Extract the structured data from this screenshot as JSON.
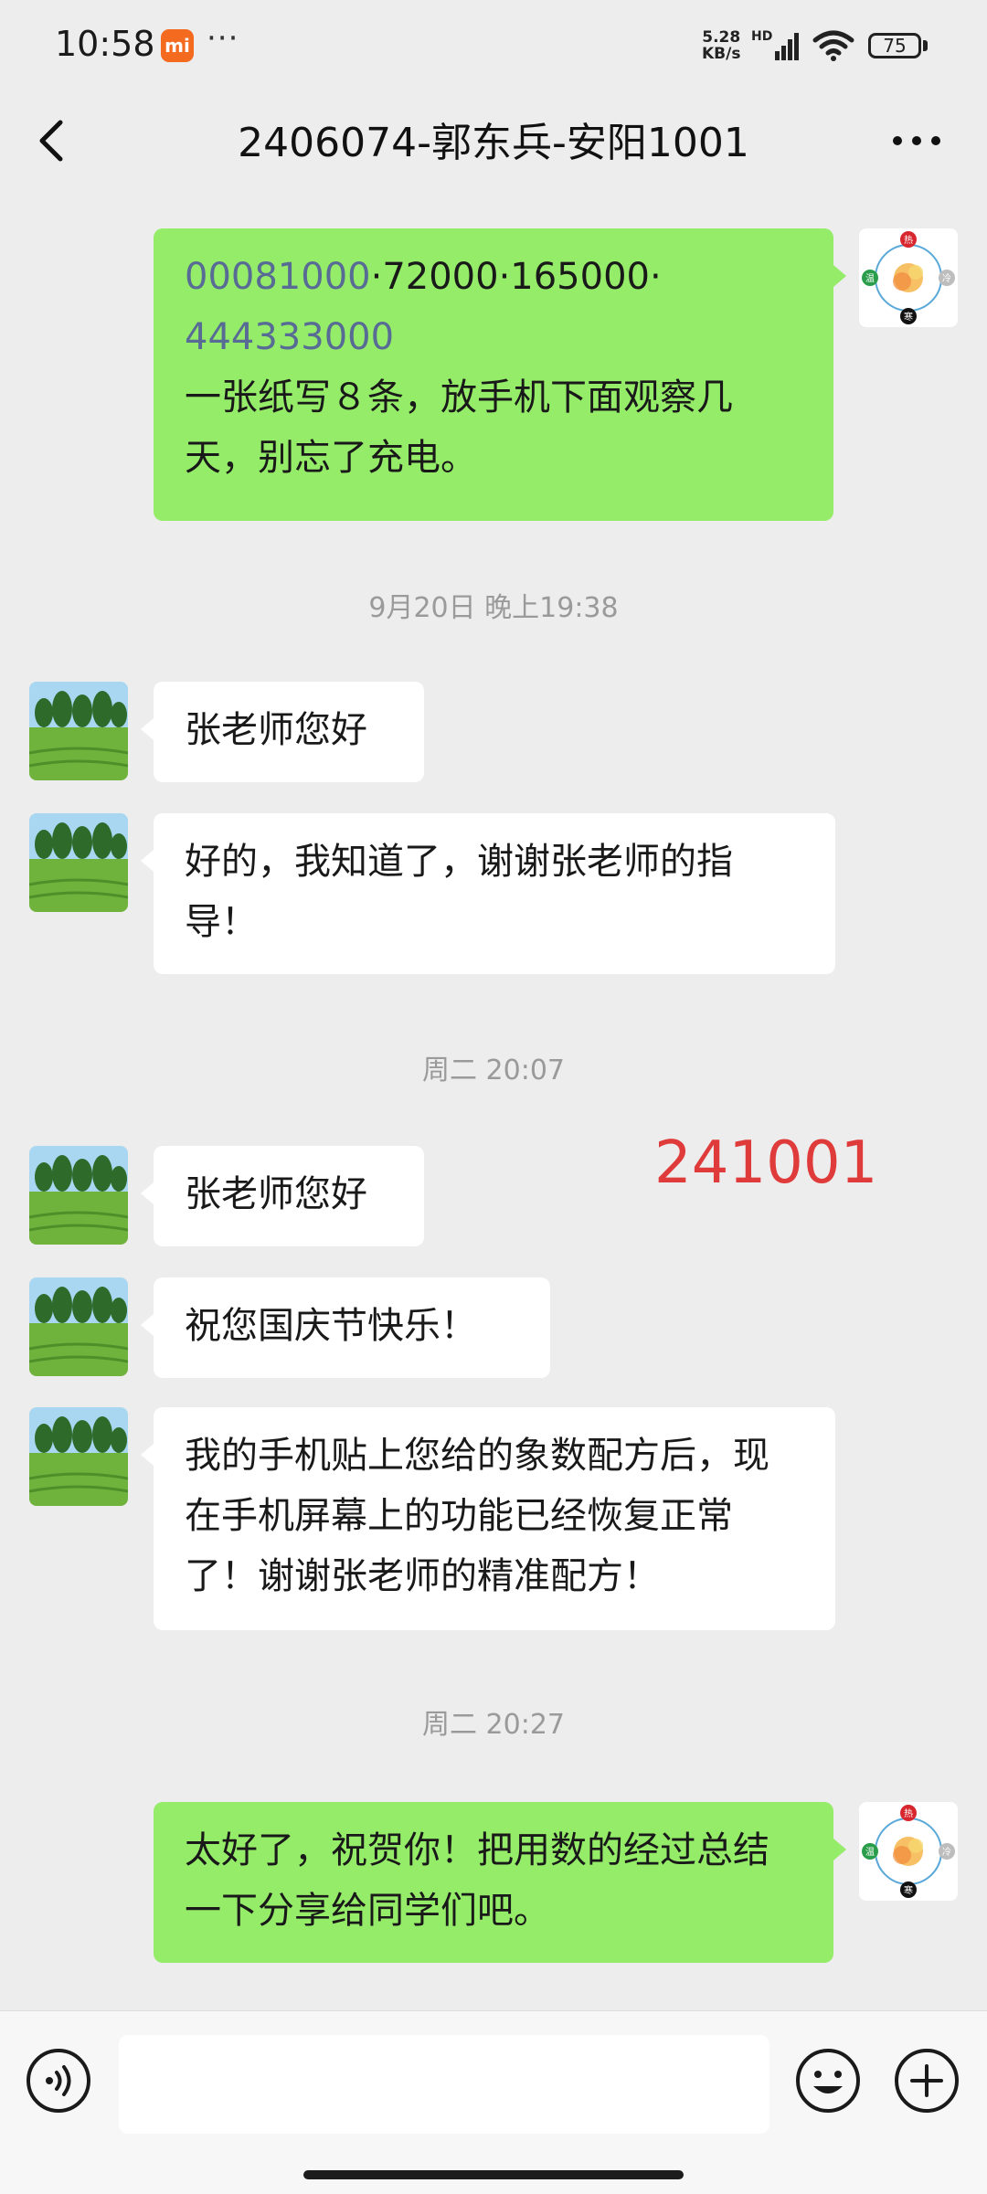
{
  "status_bar": {
    "time": "10:58",
    "mi_badge": "mi",
    "dots": "···",
    "net_speed_top": "5.28",
    "net_speed_bottom": "KB/s",
    "hd_label": "HD",
    "battery": "75",
    "icons": [
      "signal-icon",
      "wifi-icon",
      "battery-icon"
    ]
  },
  "header": {
    "title": "2406074-郭东兵-安阳1001",
    "icons": [
      "back-arrow-icon",
      "more-icon"
    ]
  },
  "messages": [
    {
      "type": "out",
      "link_1": "00081000",
      "sep_1": "·",
      "link_2": "72000",
      "sep_2": "·",
      "link_3": "165000",
      "sep_3": "·",
      "link_4": "444333000",
      "text": "一张纸写８条，放手机下面观察几天，别忘了充电。"
    },
    {
      "type": "timestamp",
      "text": "9月20日 晚上19:38"
    },
    {
      "type": "in",
      "text": "张老师您好"
    },
    {
      "type": "in",
      "text": "好的，我知道了，谢谢张老师的指导！"
    },
    {
      "type": "timestamp",
      "text": "周二 20:07"
    },
    {
      "type": "in",
      "text": "张老师您好"
    },
    {
      "type": "in",
      "text": "祝您国庆节快乐！"
    },
    {
      "type": "in",
      "text": "我的手机贴上您给的象数配方后，现在手机屏幕上的功能已经恢复正常了！谢谢张老师的精准配方！"
    },
    {
      "type": "timestamp",
      "text": "周二 20:27"
    },
    {
      "type": "out",
      "text": "太好了，祝贺你！把用数的经过总结一下分享给同学们吧。"
    }
  ],
  "overlay_number": "241001",
  "avatar_top_label": "热",
  "avatar_right_label": "冷",
  "avatar_left_label": "温",
  "avatar_bottom_label": "寒",
  "input_bar": {
    "icons": [
      "voice-icon",
      "emoji-icon",
      "plus-icon"
    ]
  },
  "colors": {
    "background": "#ededed",
    "outgoing_bubble": "#95ec69",
    "incoming_bubble": "#ffffff",
    "link": "#576b95",
    "overlay_red": "#e03b3b"
  }
}
